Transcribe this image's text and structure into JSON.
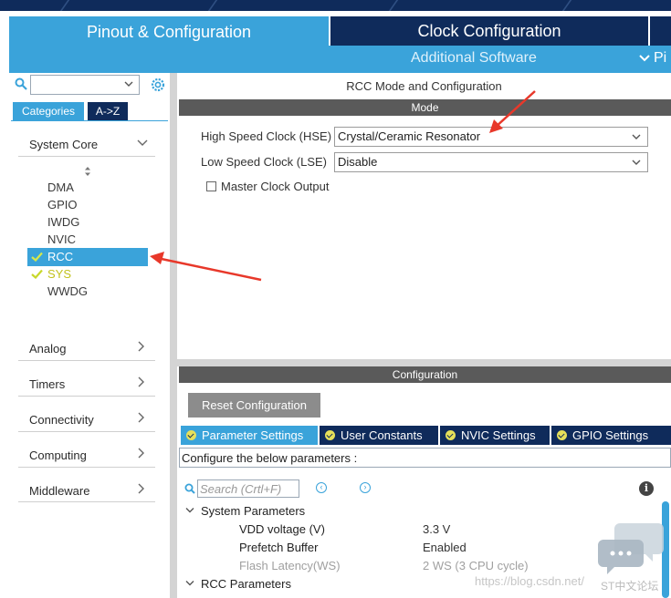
{
  "tabs": {
    "pinout": "Pinout & Configuration",
    "clock": "Clock Configuration"
  },
  "subbar": {
    "additional_software": "Additional Software",
    "pinout_short": "Pi"
  },
  "sidebar": {
    "search_value": "",
    "view_tabs": {
      "categories": "Categories",
      "az": "A->Z"
    },
    "categories": {
      "system_core": "System Core",
      "analog": "Analog",
      "timers": "Timers",
      "connectivity": "Connectivity",
      "computing": "Computing",
      "middleware": "Middleware"
    },
    "system_core_items": [
      "DMA",
      "GPIO",
      "IWDG",
      "NVIC",
      "RCC",
      "SYS",
      "WWDG"
    ],
    "selected_item": "RCC"
  },
  "mode": {
    "title": "RCC Mode and Configuration",
    "header": "Mode",
    "hse_label": "High Speed Clock (HSE)",
    "hse_value": "Crystal/Ceramic Resonator",
    "lse_label": "Low Speed Clock (LSE)",
    "lse_value": "Disable",
    "mco_label": "Master Clock Output",
    "mco_checked": false
  },
  "configuration": {
    "header": "Configuration",
    "reset_button": "Reset Configuration",
    "tabs": [
      "Parameter Settings",
      "User Constants",
      "NVIC Settings",
      "GPIO Settings"
    ],
    "active_tab": "Parameter Settings",
    "configure_text": "Configure the below parameters :",
    "search_placeholder": "Search (Crtl+F)",
    "groups": {
      "system": "System Parameters",
      "rcc": "RCC Parameters"
    },
    "params": [
      {
        "name": "VDD voltage (V)",
        "value": "3.3 V"
      },
      {
        "name": "Prefetch Buffer",
        "value": "Enabled"
      },
      {
        "name": "Flash Latency(WS)",
        "value": "2 WS (3 CPU cycle)"
      }
    ]
  },
  "watermark": "https://blog.csdn.net/",
  "logo_text": "ST中文论坛",
  "colors": {
    "dark_blue": "#0f2b5b",
    "light_blue": "#3aa3da",
    "check_yellow": "#d6d62a",
    "arrow_red": "#e8382a"
  }
}
